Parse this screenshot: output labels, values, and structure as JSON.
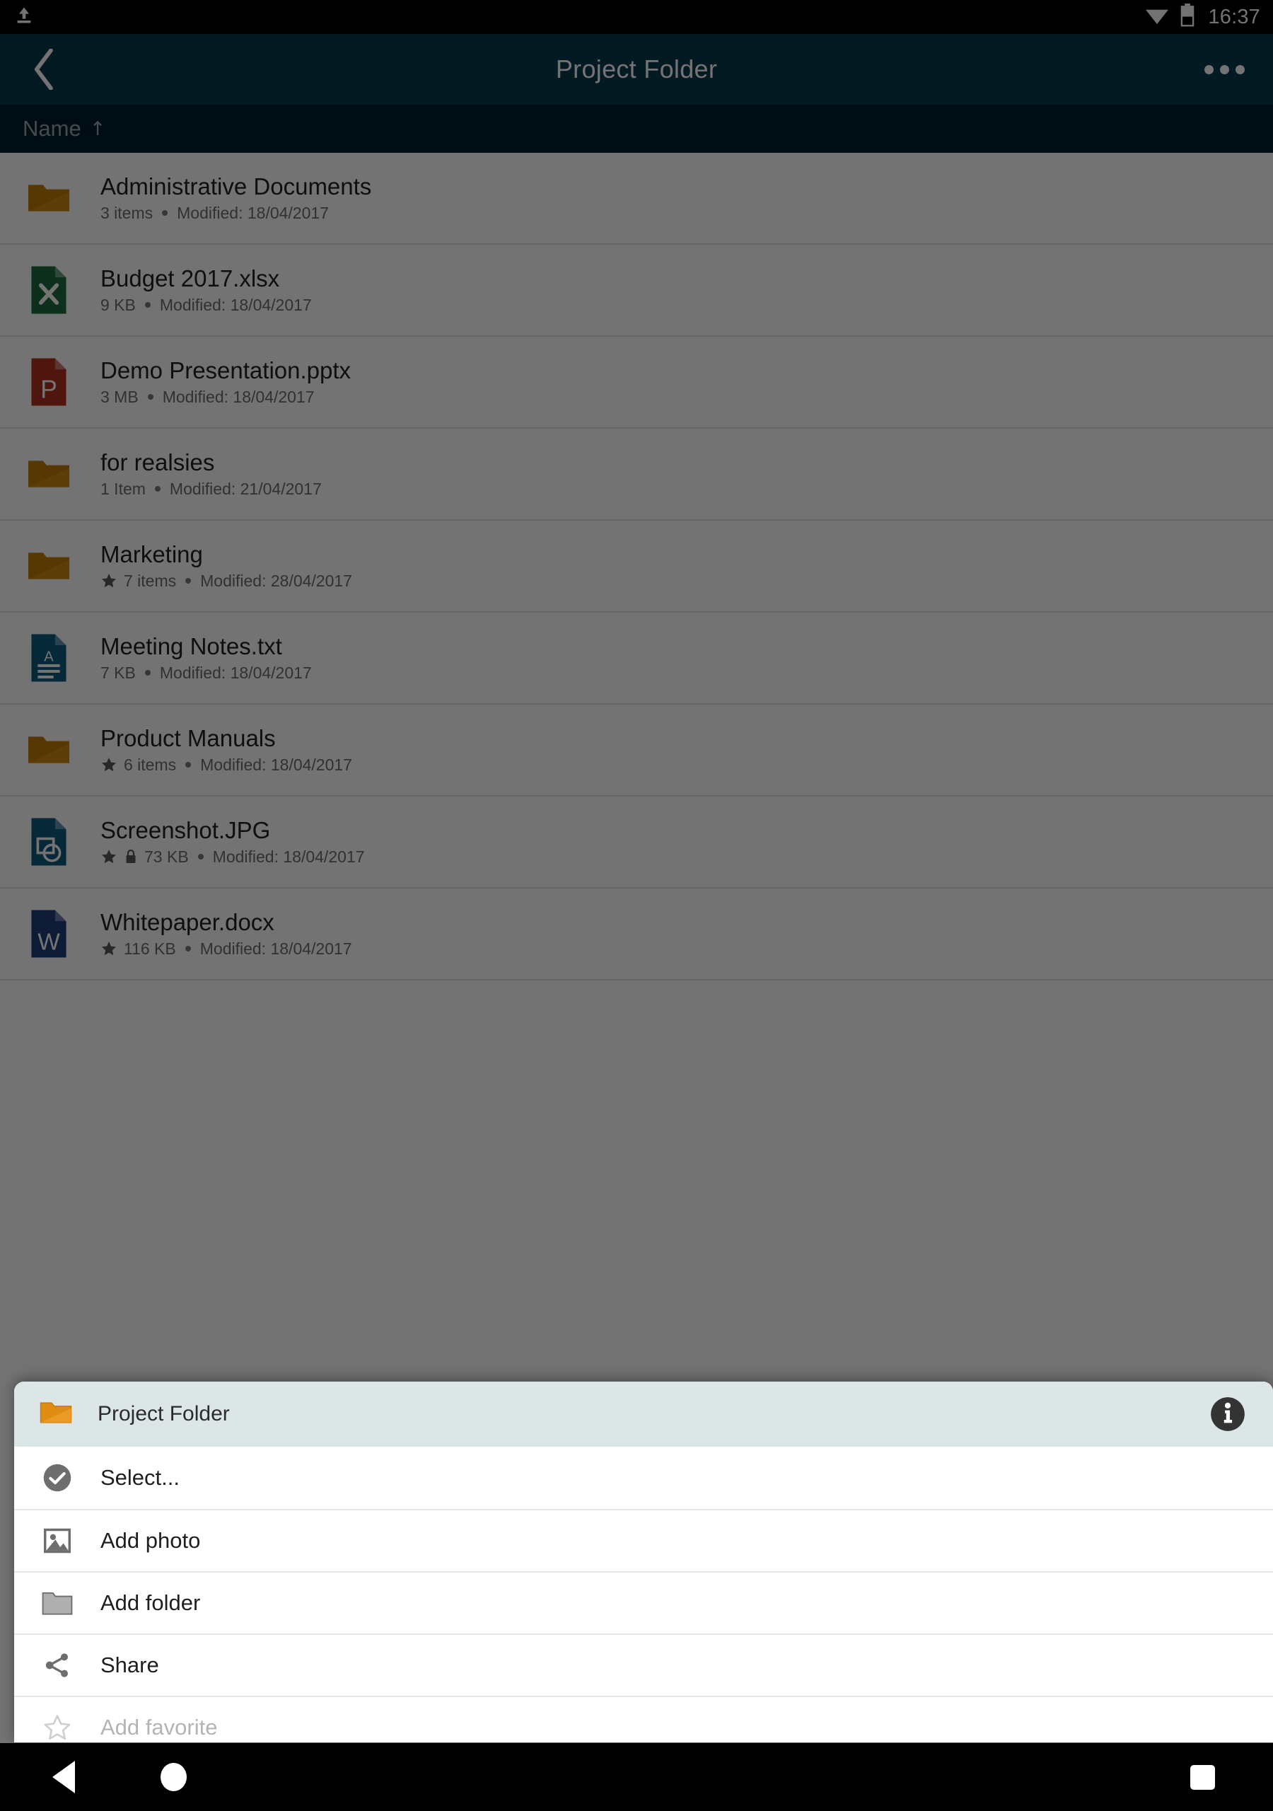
{
  "status_bar": {
    "upload_icon": "upload-icon",
    "wifi_icon": "wifi-icon",
    "battery_icon": "battery-icon",
    "time": "16:37"
  },
  "app_bar": {
    "back_icon": "chevron-left-icon",
    "title": "Project Folder",
    "overflow_icon": "overflow-menu-icon"
  },
  "sort_bar": {
    "label": "Name",
    "direction_arrow": "↑",
    "direction": "ascending"
  },
  "colors": {
    "app_bar": "#0a3b4e",
    "sort_bar": "#041d2e",
    "sheet_header": "#dde6e7",
    "folder": "#c87f0a",
    "excel": "#1d6b41",
    "powerpoint": "#b2321f",
    "word": "#1f3d7a",
    "text_file": "#0d5c7d",
    "image_file": "#0d5c7d",
    "status_bar": "#000000",
    "nav_bar": "#000000"
  },
  "file_list": {
    "items": [
      {
        "name": "Administrative Documents",
        "icon": "folder-icon",
        "type": "folder",
        "favorite": false,
        "locked": false,
        "size": "3 items",
        "modified": "Modified: 18/04/2017"
      },
      {
        "name": "Budget 2017.xlsx",
        "icon": "excel-file-icon",
        "type": "excel",
        "favorite": false,
        "locked": false,
        "size": "9 KB",
        "modified": "Modified: 18/04/2017"
      },
      {
        "name": "Demo Presentation.pptx",
        "icon": "powerpoint-file-icon",
        "type": "powerpoint",
        "favorite": false,
        "locked": false,
        "size": "3 MB",
        "modified": "Modified: 18/04/2017"
      },
      {
        "name": "for realsies",
        "icon": "folder-icon",
        "type": "folder",
        "favorite": false,
        "locked": false,
        "size": "1 Item",
        "modified": "Modified: 21/04/2017"
      },
      {
        "name": "Marketing",
        "icon": "folder-icon",
        "type": "folder",
        "favorite": true,
        "locked": false,
        "size": "7 items",
        "modified": "Modified: 28/04/2017"
      },
      {
        "name": "Meeting Notes.txt",
        "icon": "text-file-icon",
        "type": "text",
        "favorite": false,
        "locked": false,
        "size": "7 KB",
        "modified": "Modified: 18/04/2017"
      },
      {
        "name": "Product Manuals",
        "icon": "folder-icon",
        "type": "folder",
        "favorite": true,
        "locked": false,
        "size": "6 items",
        "modified": "Modified: 18/04/2017"
      },
      {
        "name": "Screenshot.JPG",
        "icon": "image-file-icon",
        "type": "image",
        "favorite": true,
        "locked": true,
        "size": "73 KB",
        "modified": "Modified: 18/04/2017"
      },
      {
        "name": "Whitepaper.docx",
        "icon": "word-file-icon",
        "type": "word",
        "favorite": true,
        "locked": false,
        "size": "116 KB",
        "modified": "Modified: 18/04/2017"
      }
    ]
  },
  "bottom_sheet": {
    "header": {
      "icon": "folder-icon",
      "title": "Project Folder",
      "info_icon": "info-icon"
    },
    "items": [
      {
        "label": "Select...",
        "icon": "check-circle-icon",
        "disabled": false
      },
      {
        "label": "Add photo",
        "icon": "image-icon",
        "disabled": false
      },
      {
        "label": "Add folder",
        "icon": "folder-outline-icon",
        "disabled": false
      },
      {
        "label": "Share",
        "icon": "share-icon",
        "disabled": false
      },
      {
        "label": "Add favorite",
        "icon": "star-outline-icon",
        "disabled": true
      }
    ]
  },
  "nav_bar": {
    "back": "back-triangle-icon",
    "home": "home-circle-icon",
    "recents": "recents-square-icon"
  }
}
